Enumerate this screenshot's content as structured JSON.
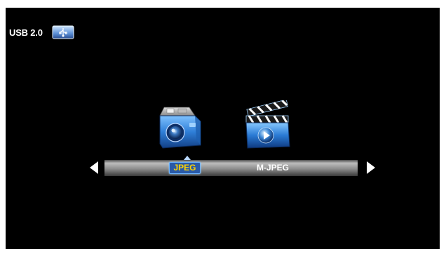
{
  "header": {
    "usb_label": "USB 2.0",
    "usb_icon": "usb-drive-icon"
  },
  "media_menu": {
    "items": [
      {
        "label": "JPEG",
        "icon": "camera-icon",
        "selected": true
      },
      {
        "label": "M-JPEG",
        "icon": "film-clapper-icon",
        "selected": false
      }
    ],
    "nav_left_icon": "arrow-left-icon",
    "nav_right_icon": "arrow-right-icon"
  },
  "colors": {
    "background": "#000000",
    "selected_text": "#ffd400",
    "selected_box": "#2a5aa8",
    "text": "#ffffff"
  }
}
